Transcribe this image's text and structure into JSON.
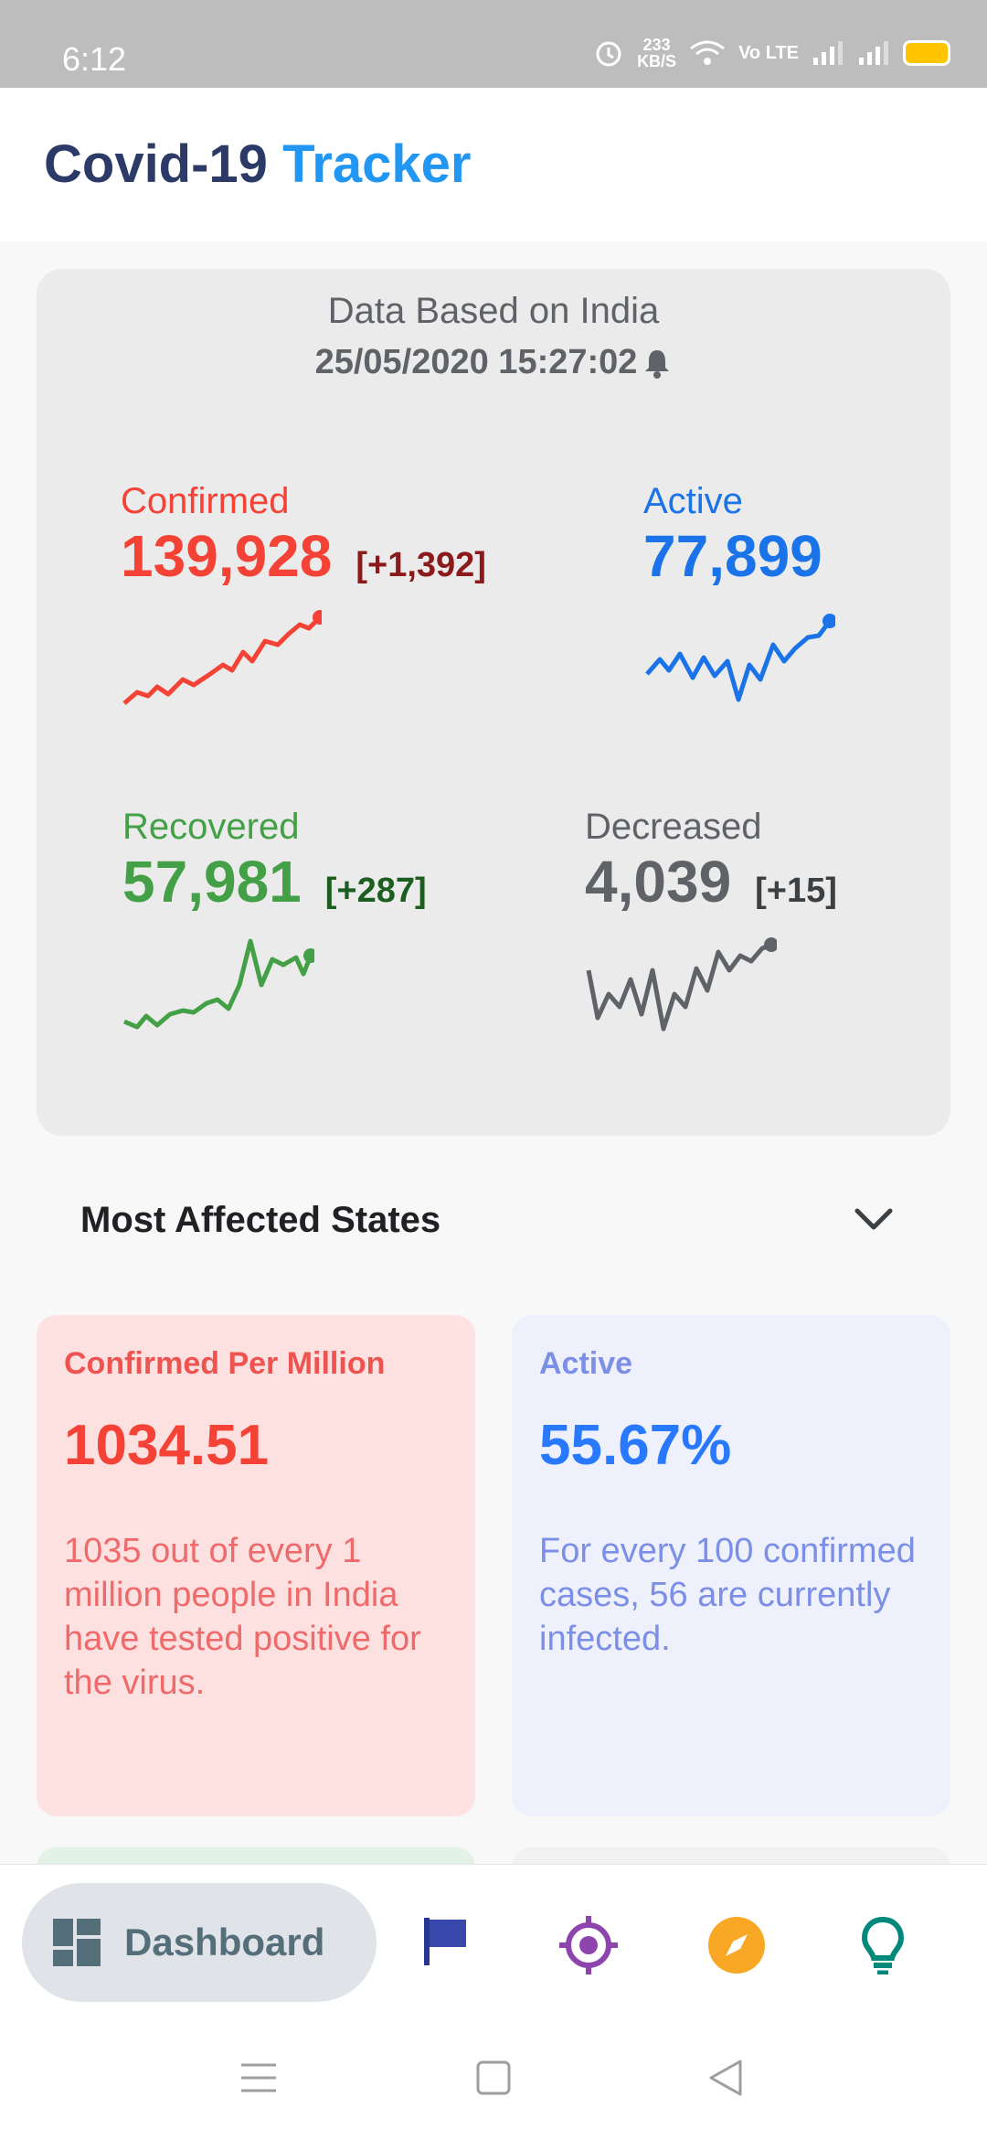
{
  "status_bar": {
    "time": "6:12",
    "net_speed_value": "233",
    "net_speed_unit": "KB/S",
    "volte": "Vo LTE"
  },
  "app": {
    "title_part1": "Covid-19",
    "title_part2": "Tracker"
  },
  "summary": {
    "based_on": "Data Based on India",
    "timestamp": "25/05/2020 15:27:02",
    "confirmed": {
      "label": "Confirmed",
      "value": "139,928",
      "delta": "[+1,392]"
    },
    "active": {
      "label": "Active",
      "value": "77,899"
    },
    "recovered": {
      "label": "Recovered",
      "value": "57,981",
      "delta": "[+287]"
    },
    "decreased": {
      "label": "Decreased",
      "value": "4,039",
      "delta": "[+15]"
    }
  },
  "section": {
    "most_affected": "Most Affected States"
  },
  "cards": [
    {
      "title": "Confirmed Per Million",
      "value": "1034.51",
      "description": "1035 out of every 1 million people in India have tested positive for the virus."
    },
    {
      "title": "Active",
      "value": "55.67%",
      "description": "For every 100 confirmed cases, 56 are currently infected."
    }
  ],
  "bottom_nav": {
    "active_label": "Dashboard",
    "icons": [
      "dashboard-icon",
      "flag-icon",
      "target-icon",
      "compass-icon",
      "lightbulb-icon"
    ]
  },
  "colors": {
    "confirmed": "#f44336",
    "active": "#1a73e8",
    "recovered": "#43a047",
    "decreased": "#5f6368",
    "brand_dark": "#2b3a67",
    "brand_blue": "#2196f3"
  }
}
